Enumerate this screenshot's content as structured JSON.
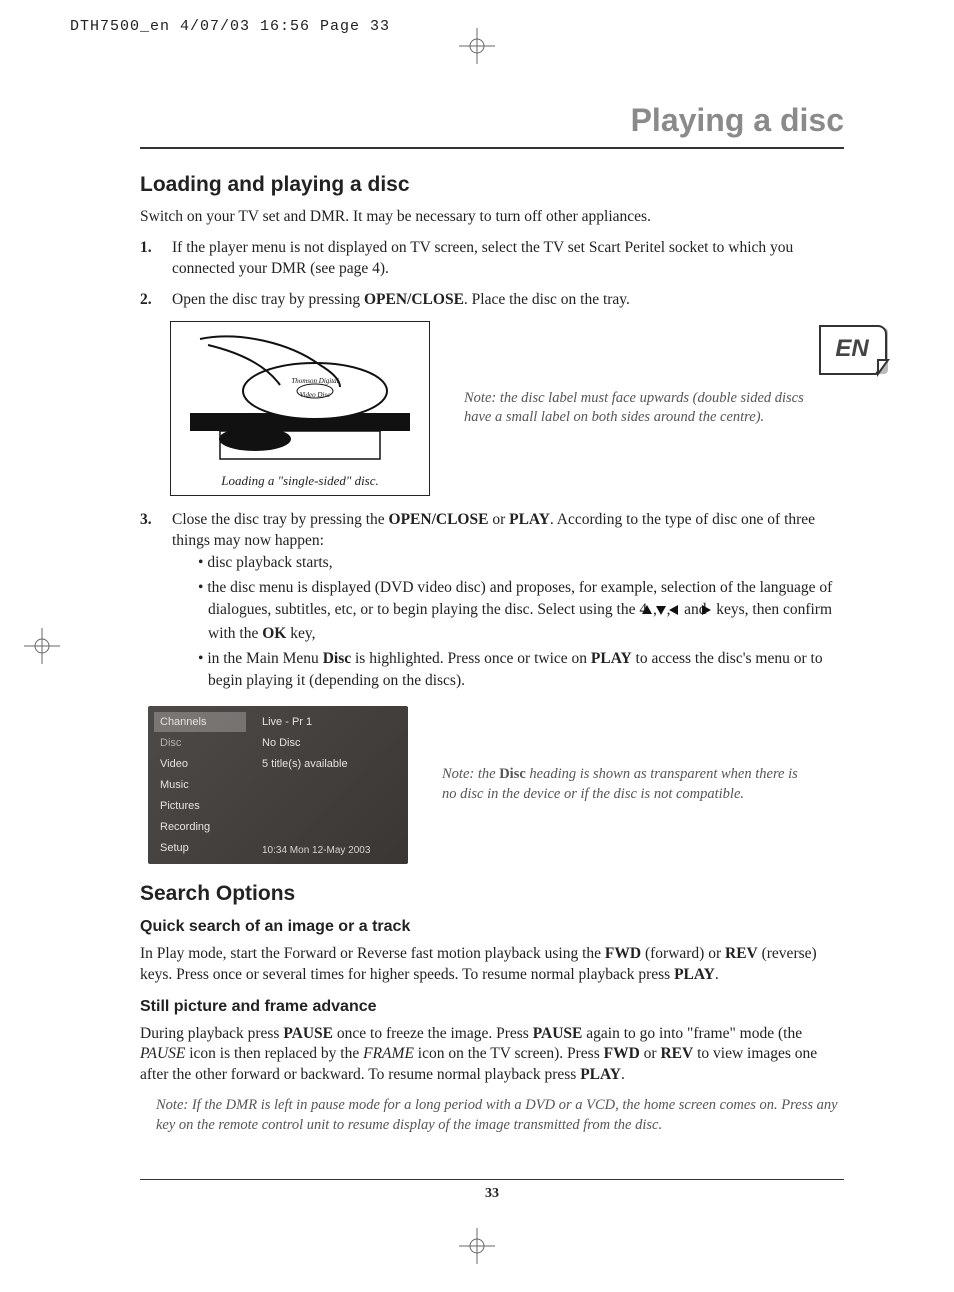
{
  "header_strip": "DTH7500_en  4/07/03  16:56  Page 33",
  "page_title": "Playing a disc",
  "lang_badge": "EN",
  "section1": {
    "heading": "Loading and playing a disc",
    "intro": "Switch on your TV set and DMR. It may be necessary to turn off other appliances.",
    "step1_num": "1.",
    "step1_txt": "If the player menu is not displayed on TV screen, select the TV set Scart Peritel socket to which you connected your DMR (see page 4).",
    "step2_num": "2.",
    "step2_pre": "Open the disc tray by pressing ",
    "step2_bold": "OPEN/CLOSE",
    "step2_post": ". Place the disc on the tray.",
    "fig_caption": "Loading a \"single-sided\" disc.",
    "fig_disc_text1": "Thomson Digital",
    "fig_disc_text2": "Video Disc",
    "note1": "Note: the disc label must face upwards (double sided discs have a small label on both sides around the centre).",
    "step3_num": "3.",
    "step3_a": "Close the disc tray by pressing the ",
    "step3_b": "OPEN/CLOSE",
    "step3_c": " or ",
    "step3_d": "PLAY",
    "step3_e": ". According to the type of disc one of three things may now happen:",
    "bullet1": "disc playback starts,",
    "bullet2_a": "the disc menu is displayed (DVD video disc) and proposes, for example, selection of the language of dialogues, subtitles, etc, or to begin playing the disc. Select using the 4 ",
    "bullet2_b": " and ",
    "bullet2_c": " keys, then confirm with the ",
    "bullet2_ok": "OK",
    "bullet2_d": " key,",
    "bullet3_a": "in the Main Menu ",
    "bullet3_disc": "Disc",
    "bullet3_b": " is highlighted. Press once or twice on ",
    "bullet3_play": "PLAY",
    "bullet3_c": " to access the disc's menu or to begin playing it (depending on the discs)."
  },
  "menu": {
    "left": [
      "Channels",
      "Disc",
      "Video",
      "Music",
      "Pictures",
      "Recording",
      "Setup"
    ],
    "right_top": [
      "Live - Pr 1",
      "No Disc",
      "5 title(s) available"
    ],
    "timestamp": "10:34 Mon 12-May 2003"
  },
  "note2_a": "Note: the ",
  "note2_bold": "Disc",
  "note2_b": " heading is shown as transparent when there is no disc in the device or if the disc is not compatible.",
  "section2": {
    "heading": "Search Options",
    "sub1": "Quick search of an image or a track",
    "para1_a": "In Play mode, start the Forward or Reverse fast motion playback using the ",
    "para1_fwd": "FWD",
    "para1_b": " (forward) or ",
    "para1_rev": "REV",
    "para1_c": " (reverse) keys. Press once or several times for higher speeds. To resume normal playback press ",
    "para1_play": "PLAY",
    "para1_d": ".",
    "sub2": "Still picture and frame advance",
    "para2_a": "During playback press ",
    "para2_pause1": "PAUSE",
    "para2_b": " once to freeze the image. Press ",
    "para2_pause2": "PAUSE",
    "para2_c": " again to go into \"frame\" mode (the ",
    "para2_pauseit": "PAUSE",
    "para2_d": " icon is then replaced by the ",
    "para2_frameit": "FRAME",
    "para2_e": " icon on the TV screen). Press ",
    "para2_fwd": "FWD",
    "para2_f": " or ",
    "para2_rev": "REV",
    "para2_g": " to view images one after the other forward or backward. To resume normal playback press ",
    "para2_play": "PLAY",
    "para2_h": ".",
    "note3": "Note: If the DMR is left in pause mode for a long period with a DVD or a VCD, the home screen comes on. Press any key on the remote control unit to resume display of the image transmitted from the disc."
  },
  "page_number": "33"
}
